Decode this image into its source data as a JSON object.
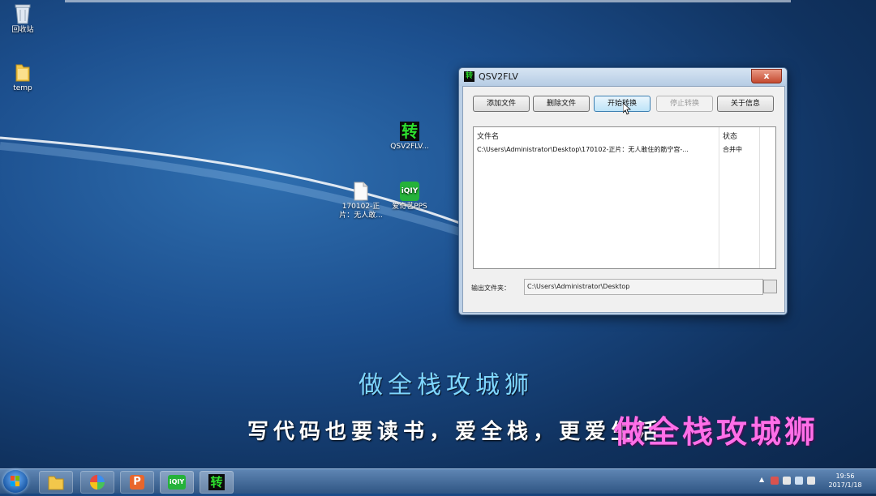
{
  "desktop": {
    "icons": [
      {
        "label": "回收站"
      },
      {
        "label": "temp"
      },
      {
        "label": "QSV2FLV..."
      },
      {
        "label": "170102-正片：无人敢..."
      },
      {
        "label": "爱奇艺PPS"
      }
    ],
    "app_glyph": "转"
  },
  "window": {
    "title": "QSV2FLV",
    "close": "x",
    "buttons": {
      "add": "添加文件",
      "delete": "删除文件",
      "start": "开始转换",
      "stop": "停止转换",
      "about": "关于信息"
    },
    "list": {
      "col_name": "文件名",
      "col_status": "状态",
      "rows": [
        {
          "name": "C:\\Users\\Administrator\\Desktop\\170102-正片：无人敢住的筋宁宫-...",
          "status": "合并中"
        }
      ]
    },
    "output_label": "输出文件夹：",
    "output_path": "C:\\Users\\Administrator\\Desktop"
  },
  "subtitles": {
    "line1": "做全栈攻城狮",
    "line2": "写代码也要读书，爱全栈，更爱生活",
    "line3": "做全栈攻城狮"
  },
  "taskbar": {
    "time": "19:56",
    "date": "2017/1/18",
    "pinned_glyph": "转"
  }
}
